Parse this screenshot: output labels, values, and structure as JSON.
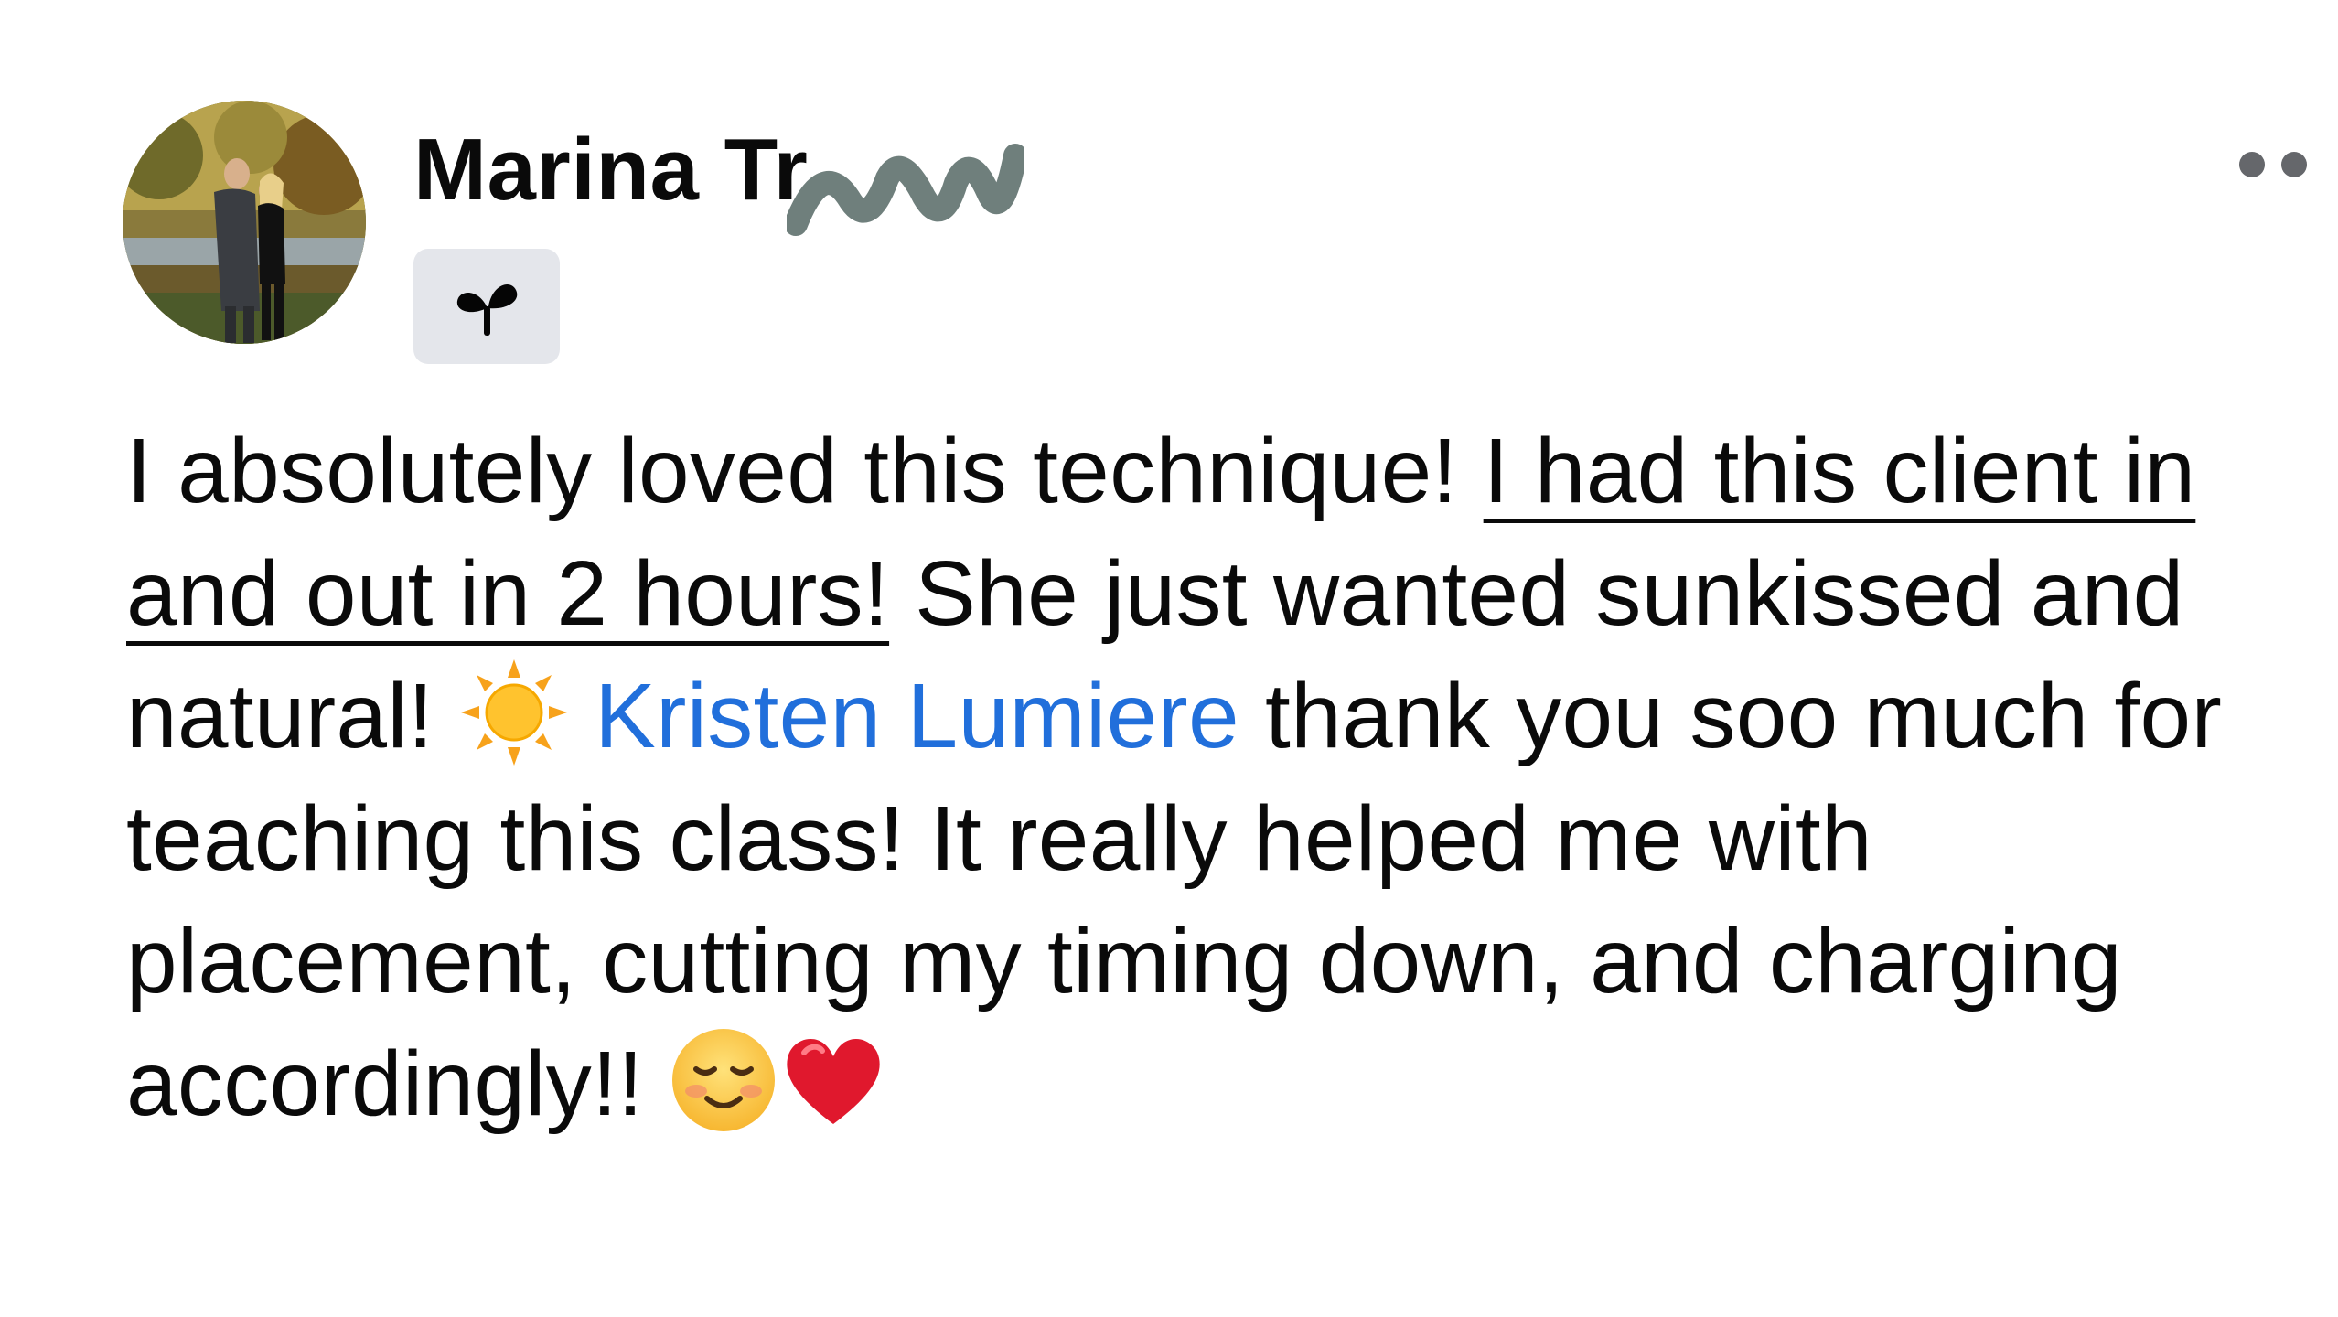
{
  "post": {
    "author": {
      "name": "Marina Tr",
      "name_redacted": true,
      "badge_icon": "sprout-icon"
    },
    "more_icon": "more-options-icon",
    "body": {
      "text_1": "I absolutely loved this technique! ",
      "underlined_text": "I had this client in and out in 2 hours!",
      "text_2": " She just wanted sunkissed and natural! ",
      "emoji_1": "sun-emoji",
      "mention": "Kristen Lumiere",
      "text_3": " thank you soo much for teaching this class! It really helped me with placement, cutting my timing down, and charging accordingly!! ",
      "emoji_2": "smiling-face-emoji",
      "emoji_3": "red-heart-emoji"
    },
    "colors": {
      "mention": "#216fdb",
      "badge_bg": "#e4e6eb",
      "redaction": "#6f7f7c",
      "text": "#0a0a0a"
    }
  }
}
